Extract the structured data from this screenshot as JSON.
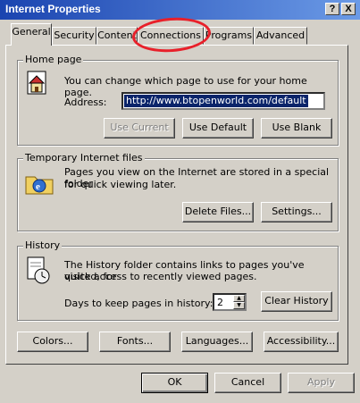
{
  "window": {
    "title": "Internet Properties"
  },
  "title_buttons": {
    "help": "?",
    "close": "X"
  },
  "tabs": [
    "General",
    "Security",
    "Content",
    "Connections",
    "Programs",
    "Advanced"
  ],
  "home_page": {
    "title": "Home page",
    "description": "You can change which page to use for your home page.",
    "address_label": "Address:",
    "address_value": "http://www.btopenworld.com/default",
    "buttons": {
      "use_current": "Use Current",
      "use_default": "Use Default",
      "use_blank": "Use Blank"
    }
  },
  "temp_files": {
    "title": "Temporary Internet files",
    "description_1": "Pages you view on the Internet are stored in a special folder",
    "description_2": "for quick viewing later.",
    "buttons": {
      "delete": "Delete Files...",
      "settings": "Settings..."
    }
  },
  "history": {
    "title": "History",
    "description_1": "The History folder contains links to pages you've visited, for",
    "description_2": "quick access to recently viewed pages.",
    "days_label": "Days to keep pages in history:",
    "days_value": "2",
    "clear_button": "Clear History"
  },
  "bottom_buttons": {
    "colors": "Colors...",
    "fonts": "Fonts...",
    "languages": "Languages...",
    "accessibility": "Accessibility..."
  },
  "dialog_buttons": {
    "ok": "OK",
    "cancel": "Cancel",
    "apply": "Apply"
  },
  "annotation_color": "#e8202a"
}
